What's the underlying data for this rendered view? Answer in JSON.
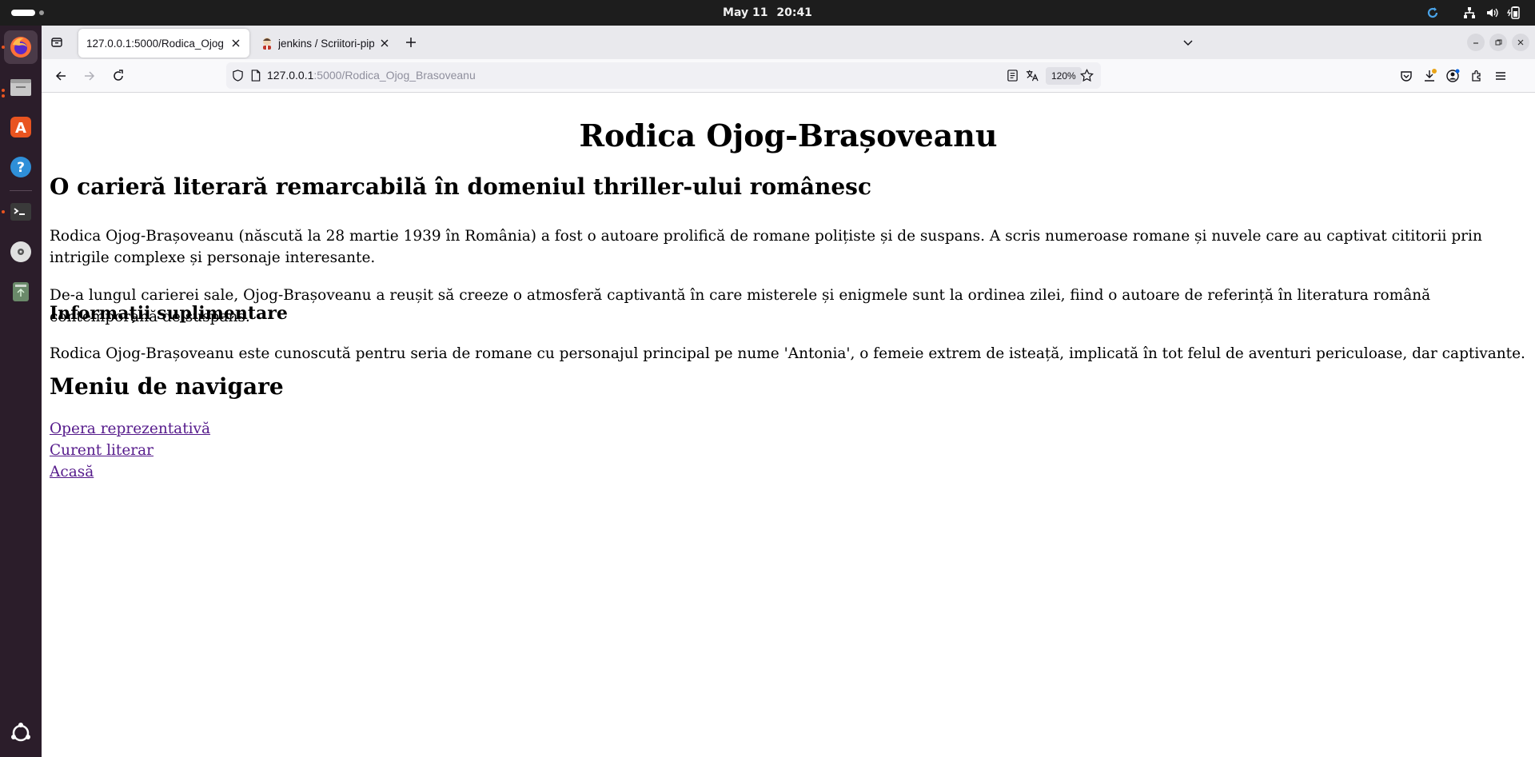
{
  "system": {
    "date": "May 11",
    "time": "20:41"
  },
  "tabs": [
    {
      "title": "127.0.0.1:5000/Rodica_Ojog",
      "active": true
    },
    {
      "title": "jenkins / Scriitori-pipeline",
      "active": false
    }
  ],
  "address": {
    "host": "127.0.0.1",
    "path": ":5000/Rodica_Ojog_Brasoveanu",
    "zoom": "120%"
  },
  "page": {
    "title": "Rodica Ojog-Brașoveanu",
    "subtitle": "O carieră literară remarcabilă în domeniul thriller-ului românesc",
    "paragraph1": "Rodica Ojog-Brașoveanu (născută la 28 martie 1939 în România) a fost o autoare prolifică de romane polițiste și de suspans. A scris numeroase romane și nuvele care au captivat cititorii prin intrigile complexe și personaje interesante.",
    "paragraph2": "De-a lungul carierei sale, Ojog-Brașoveanu a reușit să creeze o atmosferă captivantă în care misterele și enigmele sunt la ordinea zilei, fiind o autoare de referință în literatura română contemporană de suspans.",
    "info_heading": "Informații suplimentare",
    "paragraph3": "Rodica Ojog-Brașoveanu este cunoscută pentru seria de romane cu personajul principal pe nume 'Antonia', o femeie extrem de isteață, implicată în tot felul de aventuri periculoase, dar captivante.",
    "nav_heading": "Meniu de navigare",
    "links": [
      "Opera reprezentativă",
      "Curent literar",
      "Acasă"
    ]
  },
  "colors": {
    "link_visited": "#551a8b",
    "topbar": "#1d1d1d",
    "dock": "#2b1d2a",
    "ubuntu_orange": "#e95420"
  }
}
